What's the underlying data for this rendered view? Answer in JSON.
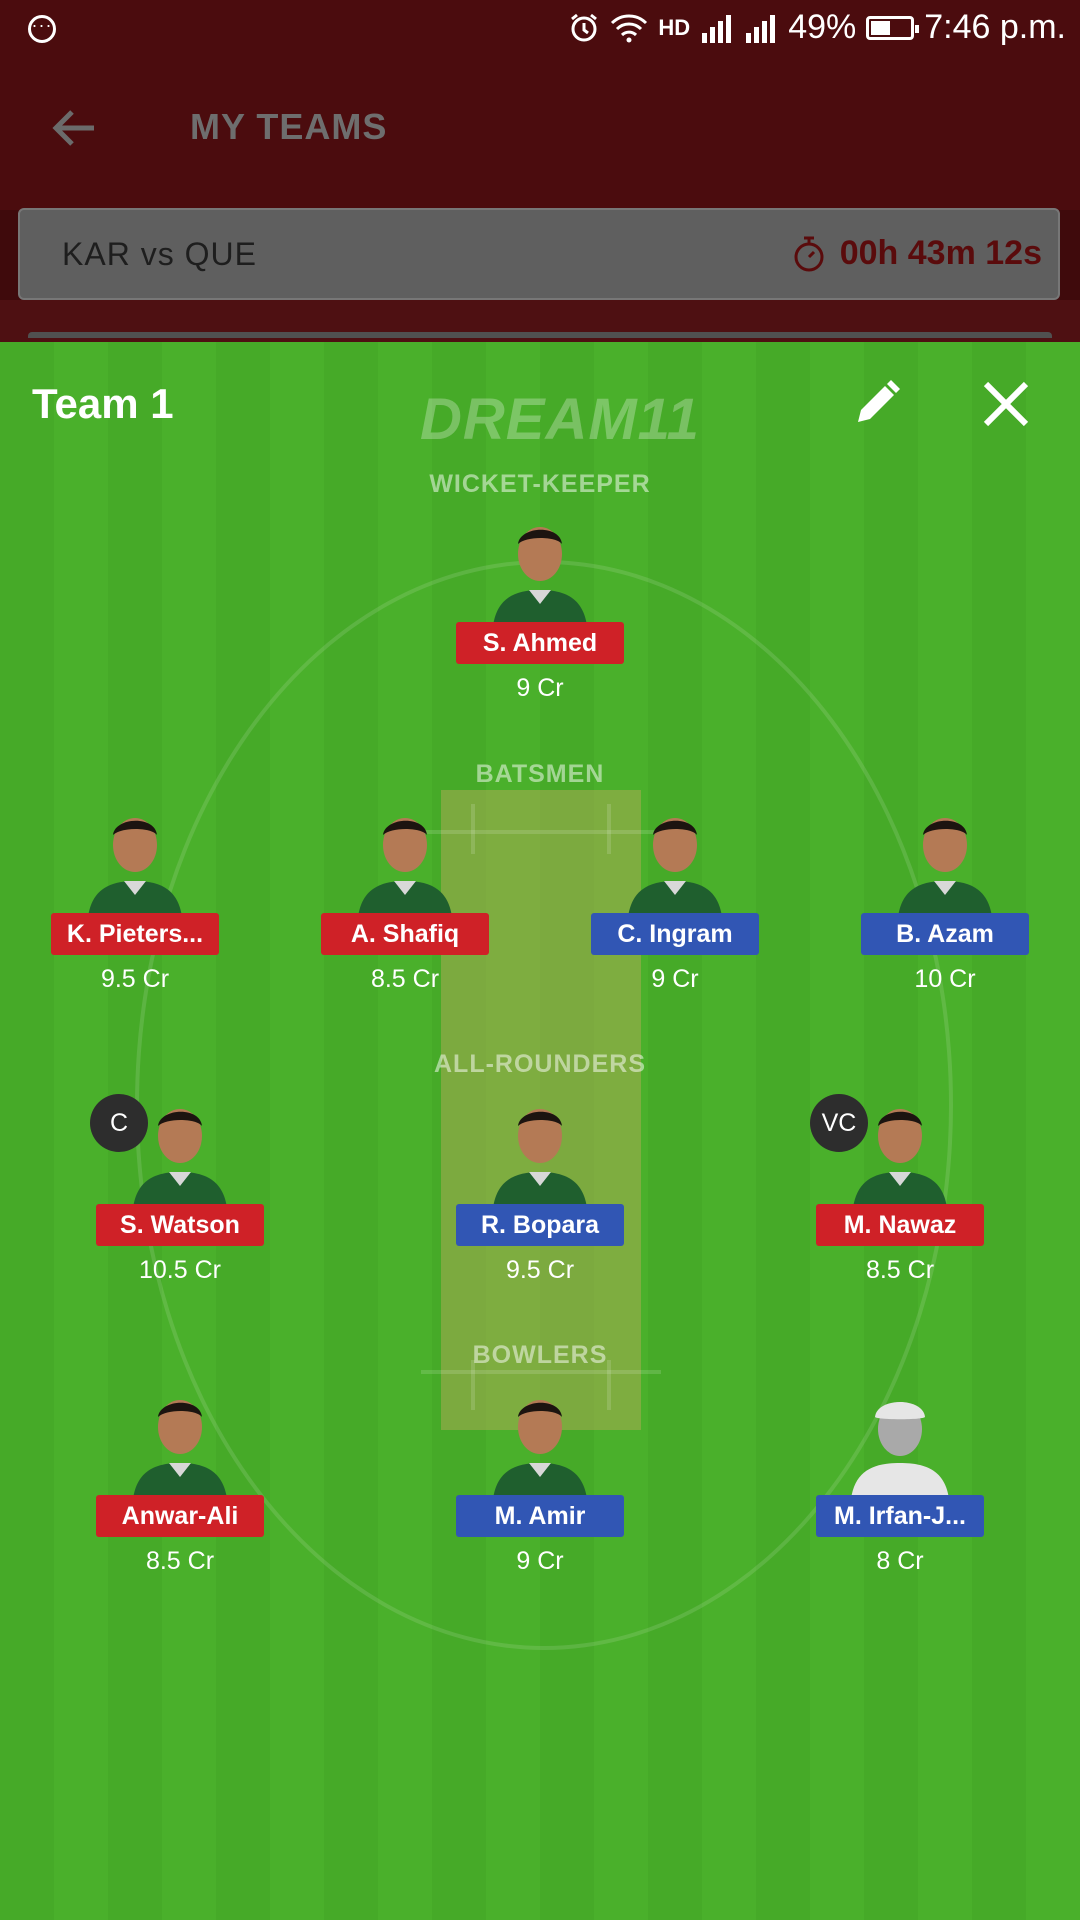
{
  "status_bar": {
    "battery_percent": "49%",
    "battery_level": 0.49,
    "time": "7:46 p.m.",
    "icons": [
      "more-icon",
      "alarm-icon",
      "wifi-icon",
      "hd-call-icon",
      "signal-icon",
      "signal-icon",
      "battery-icon"
    ]
  },
  "header": {
    "title": "MY TEAMS",
    "back_icon": "arrow-left-icon"
  },
  "match": {
    "title": "KAR vs QUE",
    "countdown": "00h 43m 12s",
    "timer_icon": "stopwatch-icon"
  },
  "team": {
    "name": "Team 1",
    "logo_text": "DREAM11",
    "edit_icon": "pencil-icon",
    "close_icon": "close-icon"
  },
  "sections": {
    "wicket_keeper": "WICKET-KEEPER",
    "batsmen": "BATSMEN",
    "all_rounders": "ALL-ROUNDERS",
    "bowlers": "BOWLERS"
  },
  "players": {
    "wk": [
      {
        "name": "S. Ahmed",
        "credit": "9 Cr",
        "tag_color": "red"
      }
    ],
    "bat": [
      {
        "name": "K. Pieters...",
        "credit": "9.5 Cr",
        "tag_color": "red"
      },
      {
        "name": "A. Shafiq",
        "credit": "8.5 Cr",
        "tag_color": "red"
      },
      {
        "name": "C. Ingram",
        "credit": "9 Cr",
        "tag_color": "blue"
      },
      {
        "name": "B. Azam",
        "credit": "10 Cr",
        "tag_color": "blue"
      }
    ],
    "ar": [
      {
        "name": "S. Watson",
        "credit": "10.5 Cr",
        "tag_color": "red",
        "badge": "C"
      },
      {
        "name": "R. Bopara",
        "credit": "9.5 Cr",
        "tag_color": "blue"
      },
      {
        "name": "M. Nawaz",
        "credit": "8.5 Cr",
        "tag_color": "red",
        "badge": "VC"
      }
    ],
    "bowl": [
      {
        "name": "Anwar-Ali",
        "credit": "8.5 Cr",
        "tag_color": "red"
      },
      {
        "name": "M. Amir",
        "credit": "9 Cr",
        "tag_color": "blue"
      },
      {
        "name": "M. Irfan-J...",
        "credit": "8 Cr",
        "tag_color": "blue"
      }
    ]
  },
  "colors": {
    "header_bg": "#4b0c0e",
    "field_green": "#46aa28",
    "tag_red": "#cf2127",
    "tag_blue": "#3156b4",
    "badge_dark": "#2d2d2d"
  }
}
